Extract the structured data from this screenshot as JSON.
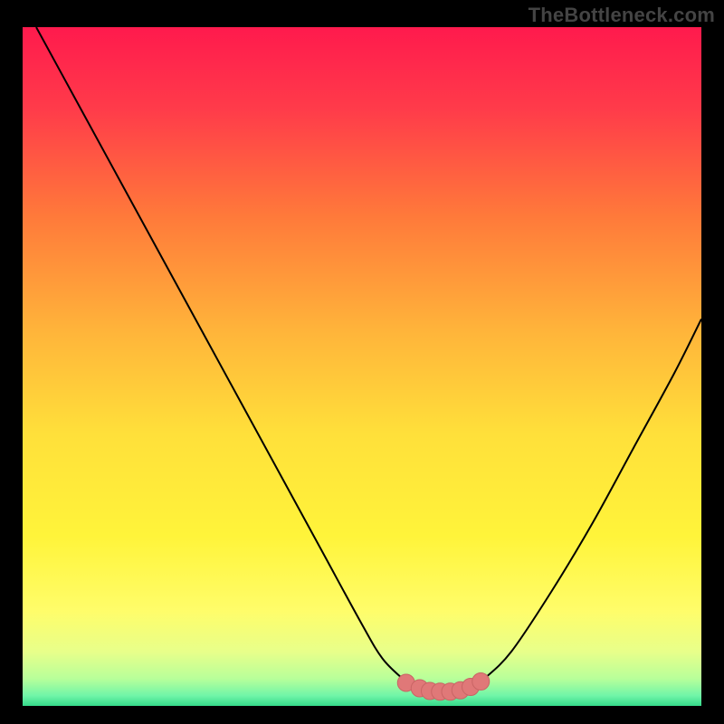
{
  "watermark": "TheBottleneck.com",
  "colors": {
    "background": "#000000",
    "gradient_stops": [
      {
        "offset": 0.0,
        "color": "#ff1a4d"
      },
      {
        "offset": 0.12,
        "color": "#ff3b4a"
      },
      {
        "offset": 0.28,
        "color": "#ff7a3a"
      },
      {
        "offset": 0.45,
        "color": "#ffb53a"
      },
      {
        "offset": 0.6,
        "color": "#ffe03a"
      },
      {
        "offset": 0.75,
        "color": "#fff43a"
      },
      {
        "offset": 0.86,
        "color": "#fffd6a"
      },
      {
        "offset": 0.92,
        "color": "#e8ff8a"
      },
      {
        "offset": 0.96,
        "color": "#b8ff9a"
      },
      {
        "offset": 0.985,
        "color": "#70f5a8"
      },
      {
        "offset": 1.0,
        "color": "#35d98a"
      }
    ],
    "curve_stroke": "#000000",
    "marker_fill": "#e07878",
    "marker_stroke": "#c96565"
  },
  "chart_data": {
    "type": "line",
    "title": "",
    "xlabel": "",
    "ylabel": "",
    "xlim": [
      0,
      100
    ],
    "ylim": [
      0,
      100
    ],
    "series": [
      {
        "name": "bottleneck-curve",
        "x": [
          2,
          8,
          14,
          20,
          26,
          32,
          38,
          44,
          50,
          53,
          56,
          58,
          60,
          62,
          64,
          66,
          68,
          72,
          78,
          84,
          90,
          96,
          100
        ],
        "y": [
          100,
          89,
          78,
          67,
          56,
          45,
          34,
          23,
          12,
          7,
          4,
          2.5,
          2,
          2,
          2,
          2.5,
          4,
          8,
          17,
          27,
          38,
          49,
          57
        ]
      }
    ],
    "markers": {
      "name": "highlight-dots",
      "x": [
        56.5,
        58.5,
        60.0,
        61.5,
        63.0,
        64.5,
        66.0,
        67.5
      ],
      "y": [
        3.4,
        2.6,
        2.2,
        2.1,
        2.1,
        2.3,
        2.8,
        3.6
      ]
    }
  }
}
